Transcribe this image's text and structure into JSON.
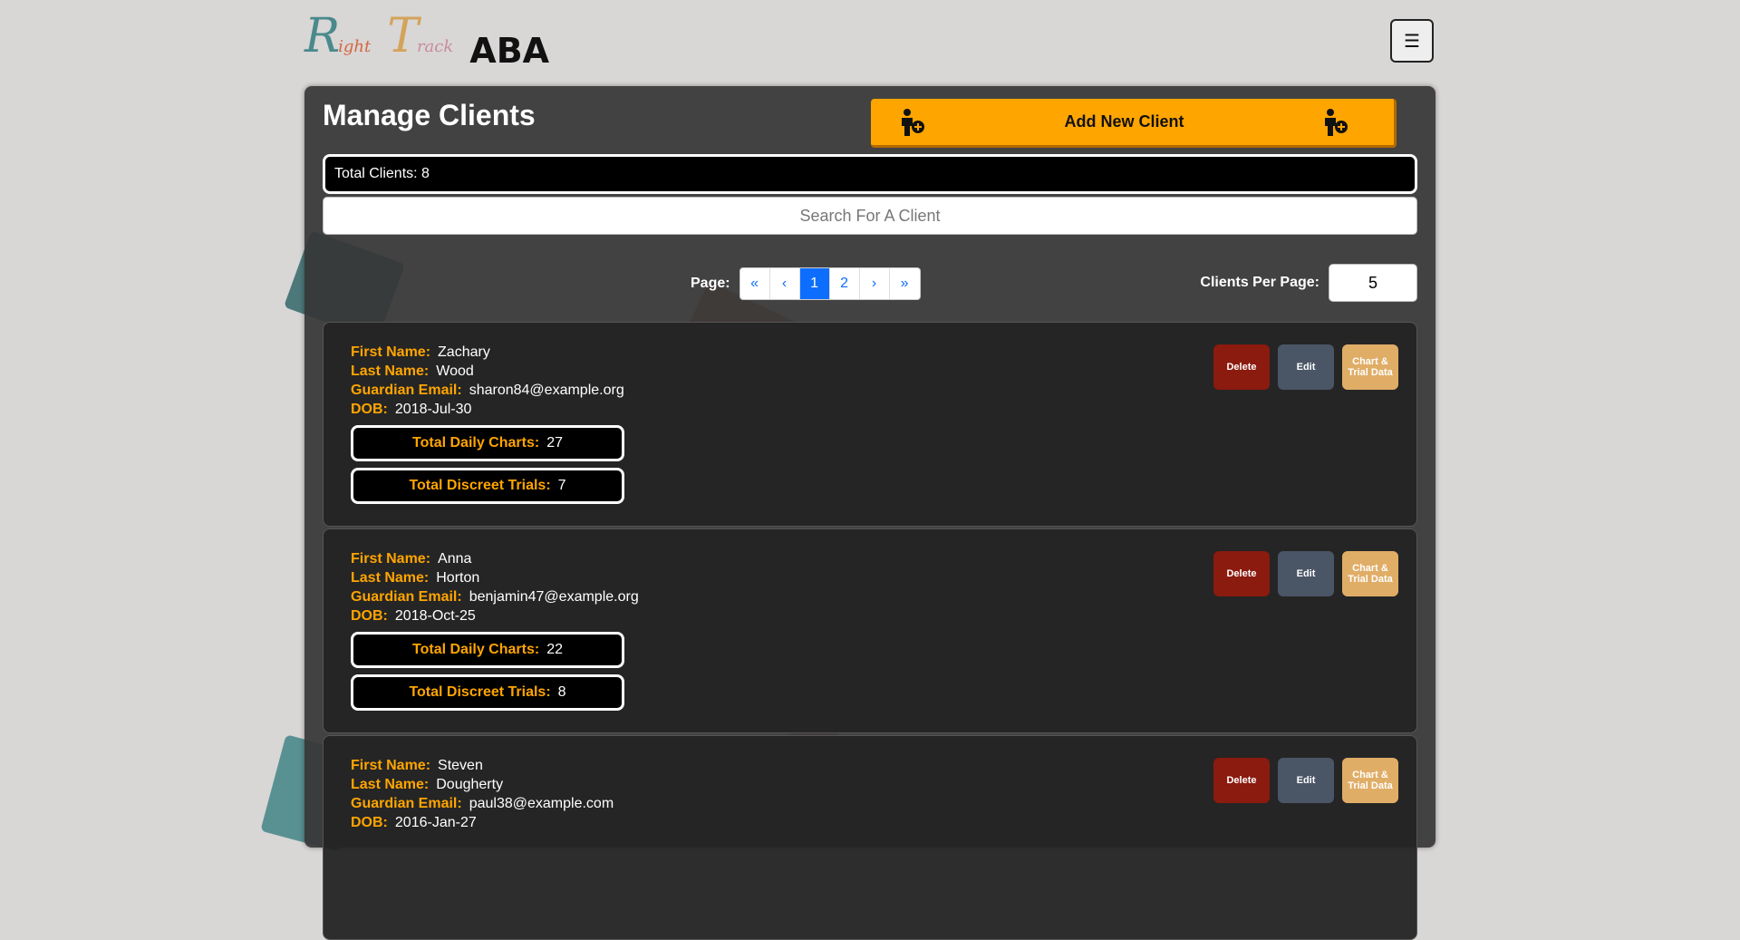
{
  "header": {
    "logo": {
      "r": "R",
      "r_small": "ight",
      "t": "T",
      "t_small": "rack",
      "aba": "ABA"
    },
    "menu_icon": "☰"
  },
  "page": {
    "title": "Manage Clients",
    "add_button": "Add New Client",
    "add_icon": "person-add-icon",
    "total_clients": "Total Clients: 8",
    "search_placeholder": "Search For A Client",
    "page_label": "Page:",
    "pages": [
      "«",
      "‹",
      "1",
      "2",
      "›",
      "»"
    ],
    "current_page": "1",
    "per_page_label": "Clients Per Page:",
    "per_page_value": "5"
  },
  "labels": {
    "first_name": "First Name:",
    "last_name": "Last Name:",
    "guardian_email": "Guardian Email:",
    "dob": "DOB:",
    "daily_charts": "Total Daily Charts:",
    "discreet_trials": "Total Discreet Trials:",
    "delete": "Delete",
    "edit": "Edit",
    "chart_trial": "Chart & Trial Data"
  },
  "clients": [
    {
      "first": "Zachary",
      "last": "Wood",
      "email": "sharon84@example.org",
      "dob": "2018-Jul-30",
      "charts": "27",
      "trials": "7"
    },
    {
      "first": "Anna",
      "last": "Horton",
      "email": "benjamin47@example.org",
      "dob": "2018-Oct-25",
      "charts": "22",
      "trials": "8"
    },
    {
      "first": "Steven",
      "last": "Dougherty",
      "email": "paul38@example.com",
      "dob": "2016-Jan-27",
      "charts": "",
      "trials": ""
    }
  ],
  "colors": {
    "accent": "#ffa500",
    "delete": "#8b1a0f",
    "edit": "#4a5566",
    "chart": "#e0ad67"
  }
}
